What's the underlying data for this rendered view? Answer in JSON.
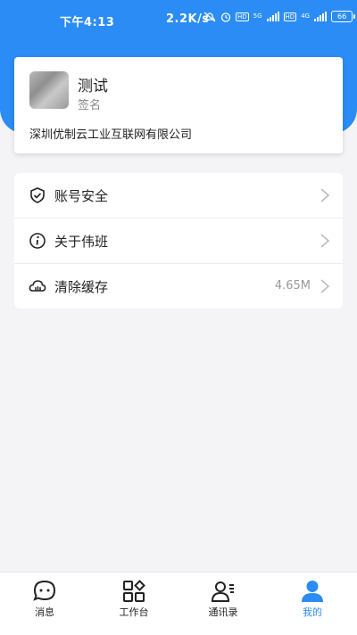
{
  "status_bar": {
    "time": "下午4:13",
    "network_speed": "2.2K/s",
    "battery": "66"
  },
  "profile": {
    "name": "测试",
    "signature": "签名",
    "company": "深圳优制云工业互联网有限公司"
  },
  "menu": {
    "items": [
      {
        "label": "账号安全",
        "icon": "shield-icon"
      },
      {
        "label": "关于伟班",
        "icon": "info-icon"
      },
      {
        "label": "清除缓存",
        "icon": "cloud-icon",
        "value": "4.65M"
      }
    ]
  },
  "bottom_nav": {
    "items": [
      {
        "label": "消息",
        "icon": "chat-icon"
      },
      {
        "label": "工作台",
        "icon": "grid-icon"
      },
      {
        "label": "通讯录",
        "icon": "contacts-icon"
      },
      {
        "label": "我的",
        "icon": "user-icon",
        "active": true
      }
    ]
  },
  "colors": {
    "accent": "#2b8cf5",
    "background": "#f4f4f6"
  }
}
